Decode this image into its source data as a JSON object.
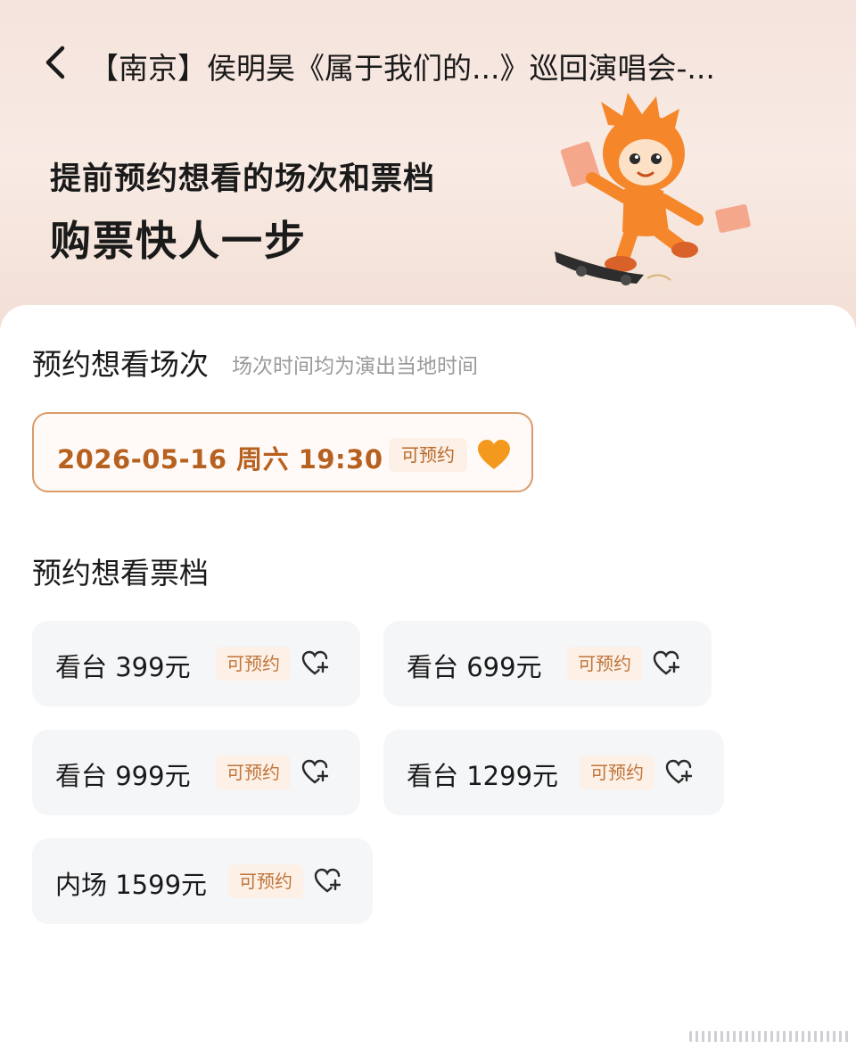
{
  "header": {
    "title": "【南京】侯明昊《属于我们的...》巡回演唱会-..."
  },
  "hero": {
    "line1": "提前预约想看的场次和票档",
    "line2": "购票快人一步"
  },
  "sessions_section": {
    "title": "预约想看场次",
    "note": "场次时间均为演出当地时间",
    "sessions": [
      {
        "date": "2026-05-16  周六 19:30",
        "badge": "可预约"
      }
    ]
  },
  "tickets_section": {
    "title": "预约想看票档",
    "tickets": [
      {
        "label": "看台 399元",
        "badge": "可预约"
      },
      {
        "label": "看台 699元",
        "badge": "可预约"
      },
      {
        "label": "看台 999元",
        "badge": "可预约"
      },
      {
        "label": "看台 1299元",
        "badge": "可预约"
      },
      {
        "label": "内场 1599元",
        "badge": "可预约"
      }
    ]
  },
  "icons": {
    "back": "chevron-left-icon",
    "session_heart": "heart-filled-icon",
    "ticket_heart": "heart-plus-icon",
    "mascot": "mascot-skateboard-illustration"
  },
  "colors": {
    "accent": "#b6611f",
    "badge_bg": "#fdf0e6",
    "badge_text": "#c0753a",
    "heart_orange": "#f39a1e",
    "hero_bg": "#f4e3dc",
    "ticket_bg": "#f5f6f8"
  }
}
